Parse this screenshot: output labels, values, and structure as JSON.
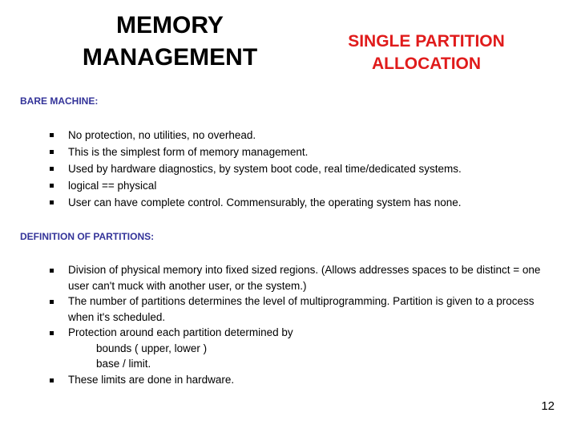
{
  "slide": {
    "title_main": "MEMORY MANAGEMENT",
    "title_sub": "SINGLE PARTITION ALLOCATION",
    "page_number": "12",
    "colors": {
      "title_main": "#000000",
      "title_sub": "#E01B1B",
      "heading": "#333399",
      "body": "#000000",
      "background": "#FFFFFF"
    }
  },
  "sections": [
    {
      "heading": "BARE MACHINE:",
      "bullets": [
        {
          "text": "No protection, no utilities, no overhead."
        },
        {
          "text": "This is the simplest form of memory management."
        },
        {
          "text": "Used by hardware diagnostics, by system boot code, real time/dedicated systems."
        },
        {
          "text": "logical == physical"
        },
        {
          "text": "User can have complete control. Commensurably, the operating system has none."
        }
      ]
    },
    {
      "heading": "DEFINITION OF PARTITIONS:",
      "bullets": [
        {
          "text": "Division of physical memory into fixed sized regions. (Allows addresses spaces to be distinct = one user can't muck with another user, or the system.)"
        },
        {
          "text": "The number of partitions determines the level of multiprogramming. Partition is given to a process when it's scheduled."
        },
        {
          "text": "Protection around each partition determined by",
          "sub_lines": [
            "bounds ( upper, lower )",
            "base  /  limit."
          ]
        },
        {
          "text": "These limits are done in hardware."
        }
      ]
    }
  ],
  "icons": {
    "bullet": "square-bullet-icon"
  }
}
